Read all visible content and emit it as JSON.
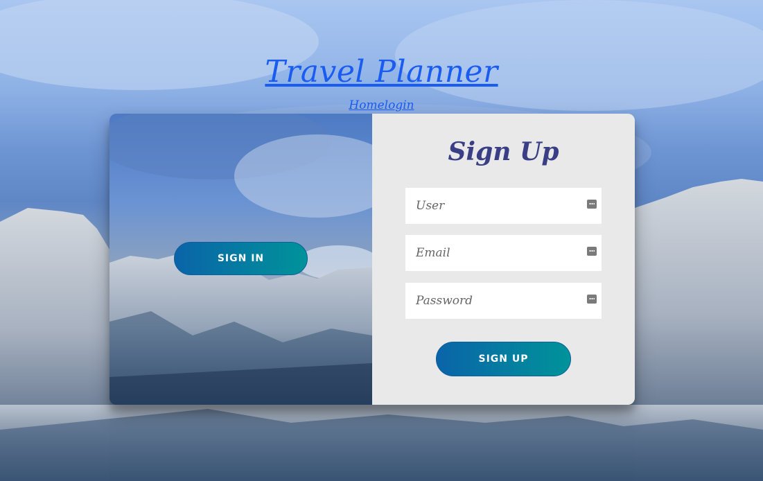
{
  "header": {
    "site_title": "Travel Planner",
    "nav_link": "Homelogin"
  },
  "overlay": {
    "signin_label": "SIGN IN"
  },
  "form": {
    "title": "Sign Up",
    "fields": [
      {
        "placeholder": "User",
        "icon": "password-manager-icon"
      },
      {
        "placeholder": "Email",
        "icon": "password-manager-icon"
      },
      {
        "placeholder": "Password",
        "icon": "password-manager-icon"
      }
    ],
    "signup_label": "SIGN UP"
  },
  "colors": {
    "link": "#1a5cf0",
    "title": "#3a3f85",
    "button_start": "#0a64a8",
    "button_end": "#00939a",
    "form_bg": "#e9e9e9"
  }
}
